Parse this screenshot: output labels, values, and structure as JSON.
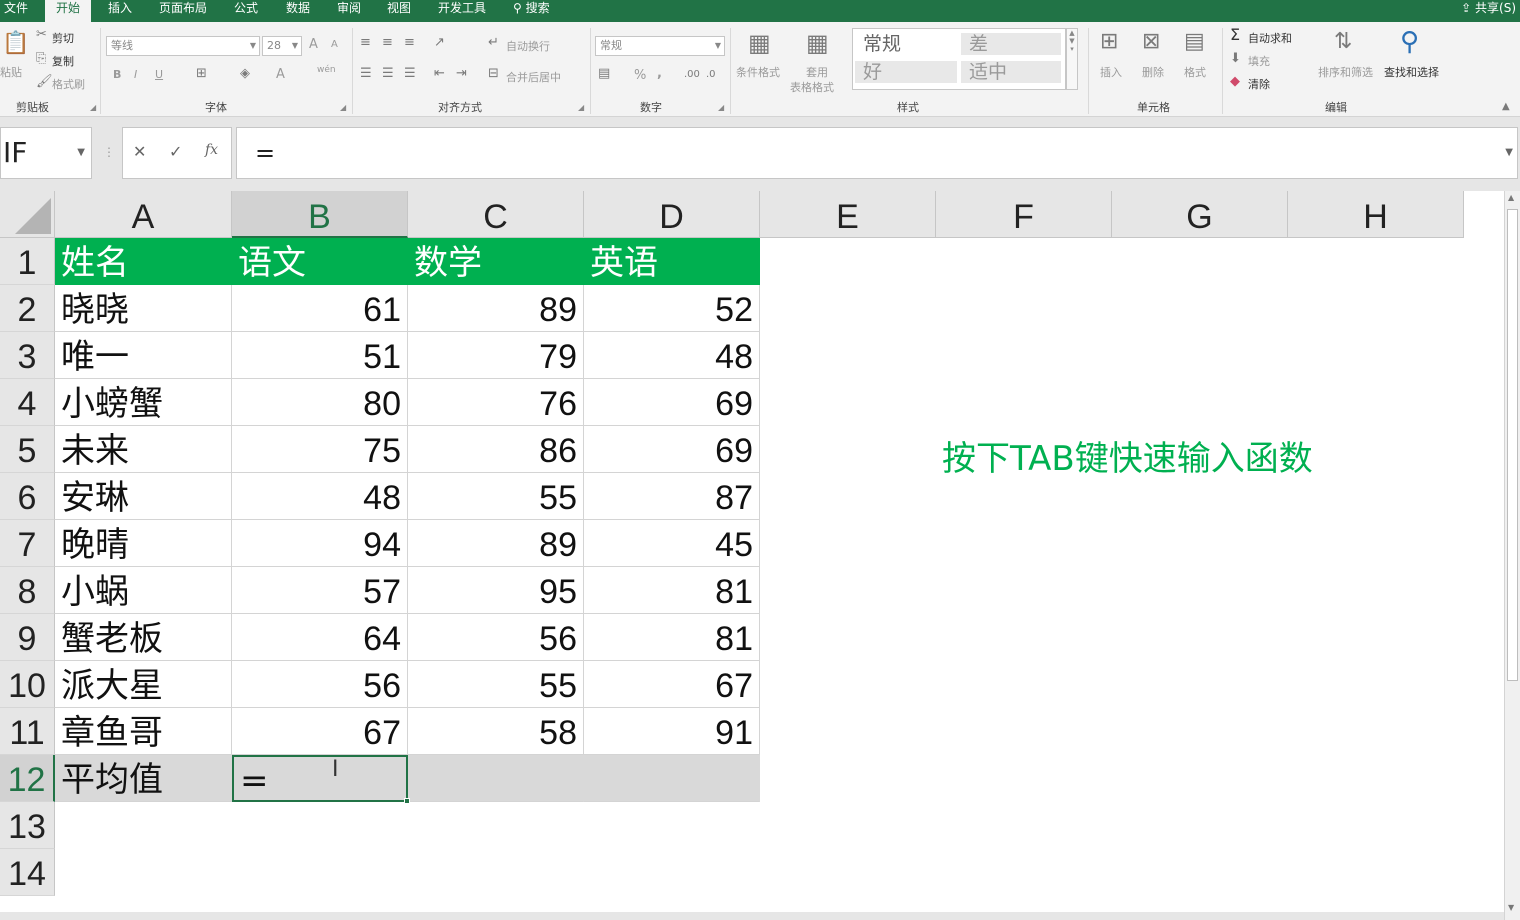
{
  "ribbon_tabs": [
    "文件",
    "开始",
    "插入",
    "页面布局",
    "公式",
    "数据",
    "审阅",
    "视图",
    "开发工具",
    "搜索"
  ],
  "share_label": "共享(S)",
  "clipboard": {
    "paste": "粘贴",
    "cut": "剪切",
    "copy": "复制",
    "format_painter": "格式刷",
    "label": "剪贴板"
  },
  "font": {
    "name": "等线",
    "size": "28",
    "bold": "B",
    "italic": "I",
    "underline": "U",
    "grow": "A",
    "shrink": "A",
    "color_a": "A",
    "wen": "wén",
    "label": "字体"
  },
  "alignment": {
    "wrap": "自动换行",
    "merge": "合并后居中",
    "label": "对齐方式"
  },
  "number": {
    "format": "常规",
    "percent": "%",
    "comma": ",",
    "label": "数字"
  },
  "styles": {
    "conditional": "条件格式",
    "table_fmt_1": "套用",
    "table_fmt_2": "表格格式",
    "normal": "常规",
    "bad": "差",
    "good": "好",
    "neutral": "适中",
    "label": "样式"
  },
  "cells_group": {
    "insert": "插入",
    "delete": "删除",
    "format": "格式",
    "label": "单元格"
  },
  "editing": {
    "autosum": "自动求和",
    "fill": "填充",
    "clear": "清除",
    "sort": "排序和筛选",
    "find": "查找和选择",
    "label": "编辑"
  },
  "formula_bar": {
    "name_box": "IF",
    "cancel": "✕",
    "enter": "✓",
    "fx": "fx",
    "content": "="
  },
  "columns": [
    "A",
    "B",
    "C",
    "D",
    "E",
    "F",
    "G",
    "H"
  ],
  "rows": [
    "1",
    "2",
    "3",
    "4",
    "5",
    "6",
    "7",
    "8",
    "9",
    "10",
    "11",
    "12",
    "13",
    "14"
  ],
  "table": {
    "header": [
      "姓名",
      "语文",
      "数学",
      "英语"
    ],
    "rows": [
      [
        "晓晓",
        "61",
        "89",
        "52"
      ],
      [
        "唯一",
        "51",
        "79",
        "48"
      ],
      [
        "小螃蟹",
        "80",
        "76",
        "69"
      ],
      [
        "未来",
        "75",
        "86",
        "69"
      ],
      [
        "安琳",
        "48",
        "55",
        "87"
      ],
      [
        "晚晴",
        "94",
        "89",
        "45"
      ],
      [
        "小蜗",
        "57",
        "95",
        "81"
      ],
      [
        "蟹老板",
        "64",
        "56",
        "81"
      ],
      [
        "派大星",
        "56",
        "55",
        "67"
      ],
      [
        "章鱼哥",
        "67",
        "58",
        "91"
      ]
    ],
    "footer_label": "平均值",
    "active_cell_value": "="
  },
  "annotation": "按下TAB键快速输入函数",
  "colors": {
    "ribbon": "#217346",
    "header_fill": "#00b050",
    "annotation": "#00b050",
    "footer_fill": "#d9d9d9"
  }
}
